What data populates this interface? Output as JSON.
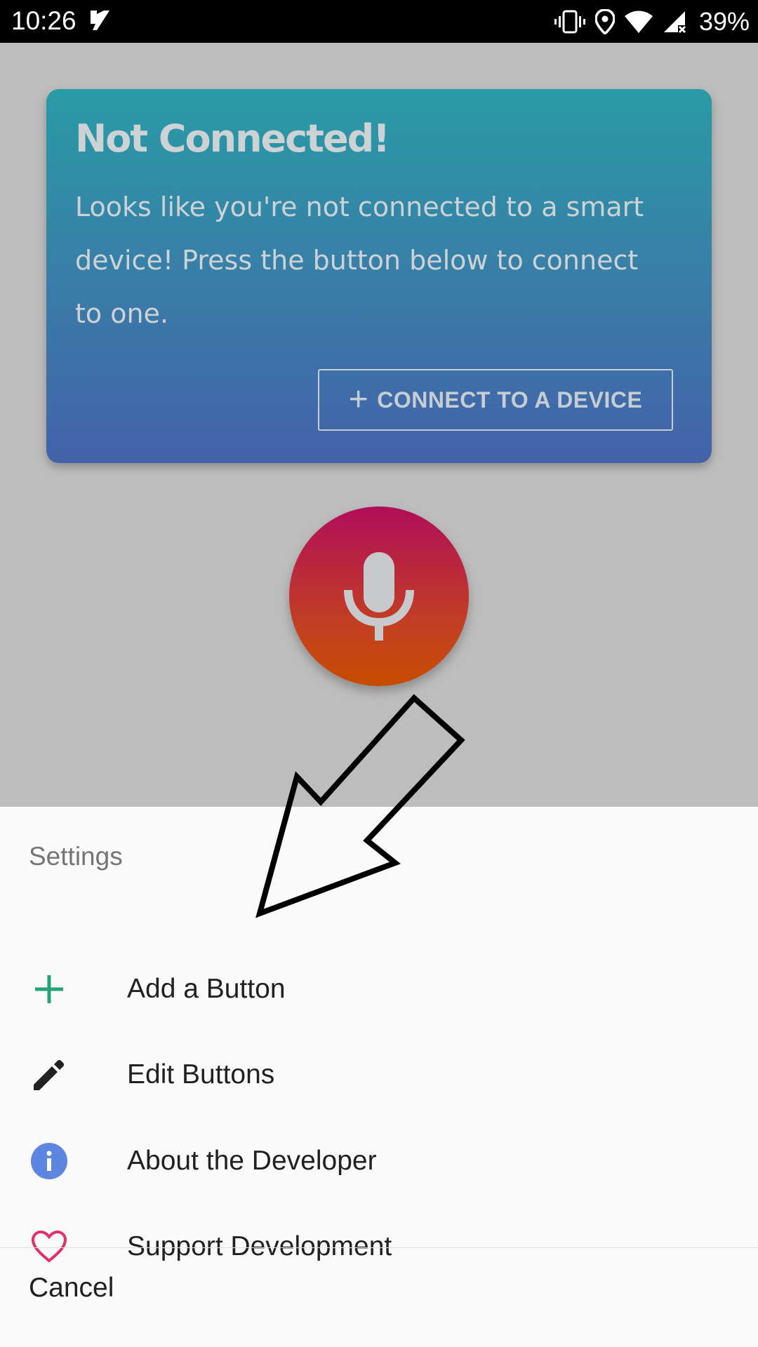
{
  "status_bar": {
    "time": "10:26",
    "battery": "39%",
    "icons": [
      "app-notification-icon",
      "vibrate-icon",
      "location-icon",
      "wifi-icon",
      "signal-icon"
    ]
  },
  "card": {
    "title": "Not Connected!",
    "body": "Looks like you're not connected to a smart device! Press the button below to connect to one.",
    "button_icon": "+",
    "button_label": "CONNECT TO A DEVICE"
  },
  "mic": {
    "icon": "microphone-icon"
  },
  "sheet": {
    "title": "Settings",
    "items": [
      {
        "label": "Add a Button",
        "icon": "plus-icon"
      },
      {
        "label": "Edit Buttons",
        "icon": "pencil-icon"
      },
      {
        "label": "About the Developer",
        "icon": "info-icon"
      },
      {
        "label": "Support Development",
        "icon": "heart-icon"
      }
    ],
    "cancel_label": "Cancel"
  },
  "colors": {
    "card_gradient_top": "#299ba5",
    "card_gradient_bottom": "#4362a9",
    "mic_gradient_top": "#b00e59",
    "mic_gradient_bottom": "#c64c00",
    "plus_icon": "#26a37a",
    "info_icon": "#5c86e0",
    "heart_icon": "#e0306a",
    "scrim": "#bdbdbd",
    "sheet_bg": "#fafafa"
  }
}
